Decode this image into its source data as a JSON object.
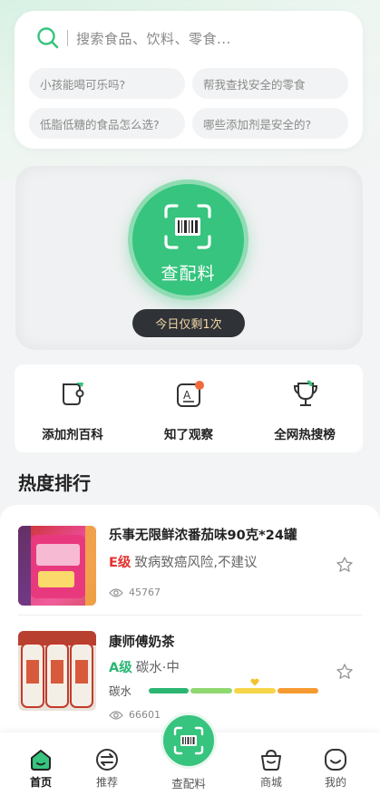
{
  "search": {
    "placeholder": "搜索食品、饮料、零食...",
    "suggestions": [
      "小孩能喝可乐吗?",
      "帮我查找安全的零食",
      "低脂低糖的食品怎么选?",
      "哪些添加剂是安全的?"
    ]
  },
  "scan": {
    "label": "查配料",
    "quota": "今日仅剩1次"
  },
  "tools": [
    "添加剂百科",
    "知了观察",
    "全网热搜榜"
  ],
  "section_title": "热度排行",
  "ranking": [
    {
      "title": "乐事无限鲜浓番茄味90克*24罐",
      "grade": "E级",
      "desc": "致病致癌风险,不建议",
      "views": "45767"
    },
    {
      "title": "康师傅奶茶",
      "grade": "A级",
      "desc": "碳水·中",
      "metric_label": "碳水",
      "views": "66601"
    }
  ],
  "nav": {
    "home": "首页",
    "recommend": "推荐",
    "scan": "查配料",
    "mall": "商城",
    "mine": "我的"
  },
  "colors": {
    "brand": "#36c47e",
    "grade_e": "#e4312f",
    "grade_a": "#2bb673"
  }
}
